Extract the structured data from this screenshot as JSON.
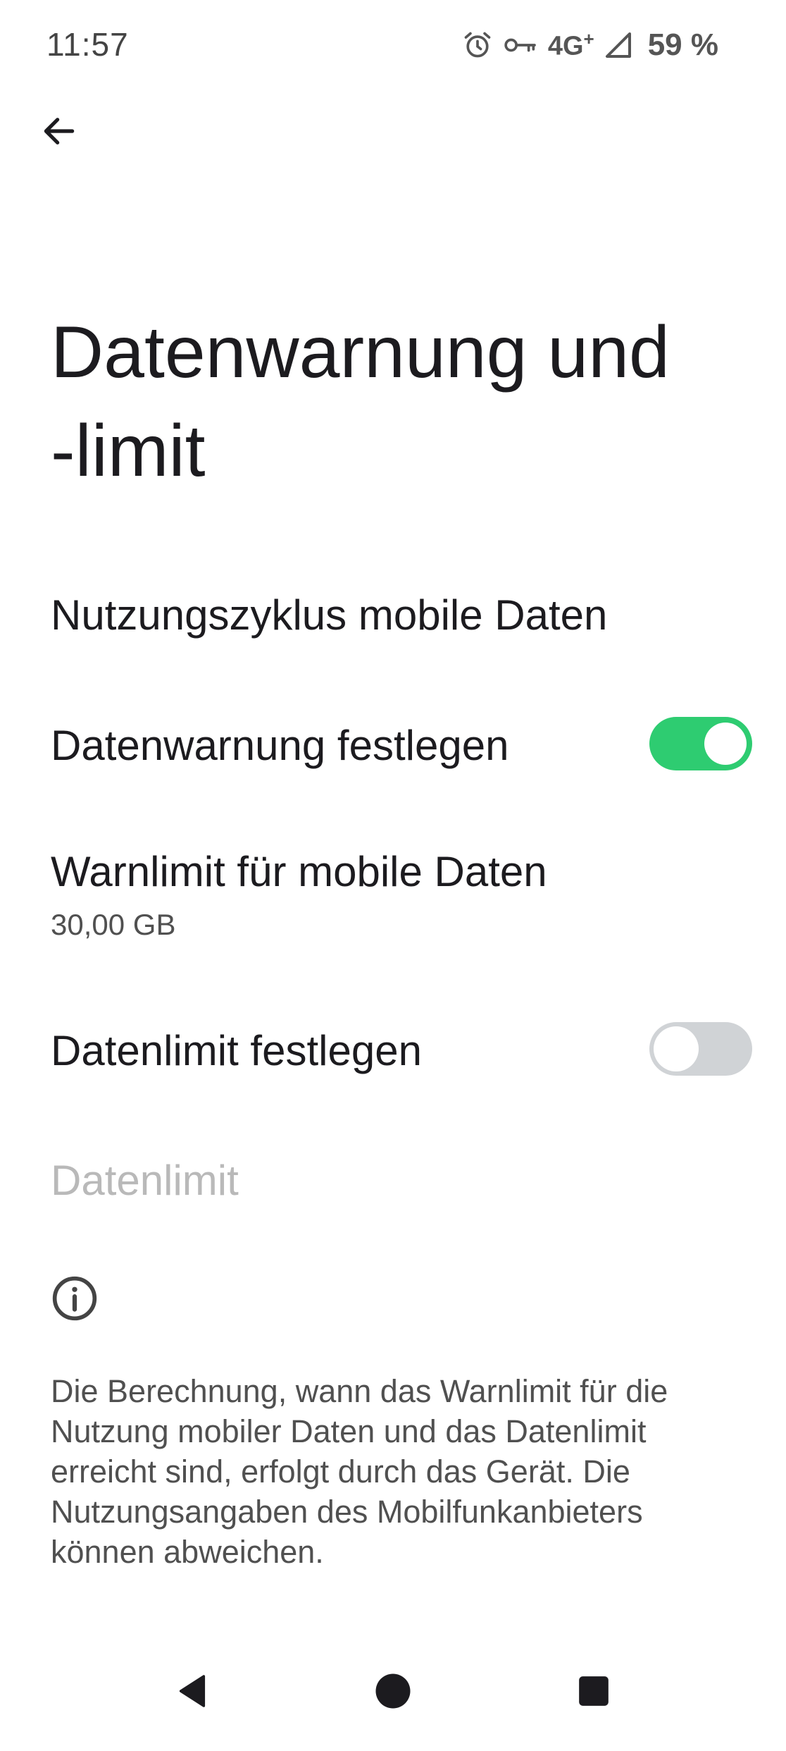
{
  "status_bar": {
    "time": "11:57",
    "network": "4G",
    "network_plus": "+",
    "battery": "59 %",
    "icons": [
      "alarm-icon",
      "vpn-key-icon",
      "signal-icon"
    ]
  },
  "header": {
    "back_icon": "arrow-back-icon",
    "title_line1": "Datenwarnung und",
    "title_line2": "-limit"
  },
  "settings": {
    "usage_cycle": {
      "label": "Nutzungszyklus mobile Daten"
    },
    "data_warning": {
      "label": "Datenwarnung festlegen",
      "enabled": true
    },
    "warning_limit": {
      "label": "Warnlimit für mobile Daten",
      "value": "30,00 GB"
    },
    "data_limit_toggle": {
      "label": "Datenlimit festlegen",
      "enabled": false
    },
    "data_limit": {
      "label": "Datenlimit",
      "disabled": true
    }
  },
  "info": {
    "icon": "info-icon",
    "text": "Die Berechnung, wann das Warnlimit für die Nutzung mobiler Daten und das Datenlimit erreicht sind, erfolgt durch das Gerät. Die Nutzungsangaben des Mobilfunkanbieters können abweichen."
  },
  "nav_bar": {
    "buttons": [
      "back-triangle-icon",
      "home-circle-icon",
      "recents-square-icon"
    ]
  },
  "colors": {
    "accent_on": "#2ecc71",
    "toggle_off": "#d0d3d6",
    "text_primary": "#1c1b1f",
    "text_secondary": "#505050",
    "text_disabled": "#b9b9b9"
  }
}
